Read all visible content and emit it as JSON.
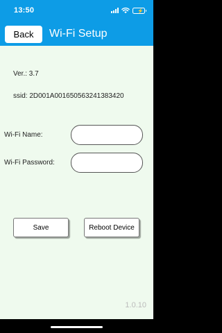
{
  "status_bar": {
    "time": "13:50",
    "icons": [
      "signal-icon",
      "wifi-icon",
      "battery-charging-icon"
    ],
    "background_color": "#0d9ce6"
  },
  "nav": {
    "back_label": "Back",
    "title": "Wi-Fi Setup",
    "background_color": "#0d9ce6"
  },
  "info": {
    "version": "Ver.: 3.7",
    "ssid": "ssid: 2D001A001650563241383420"
  },
  "form": {
    "wifi_name_label": "Wi-Fi Name:",
    "wifi_name_value": "",
    "wifi_password_label": "Wi-Fi Password:",
    "wifi_password_value": ""
  },
  "actions": {
    "save_label": "Save",
    "reboot_label": "Reboot Device"
  },
  "footer": {
    "app_version": "1.0.10"
  },
  "colors": {
    "content_background": "#effaee"
  }
}
